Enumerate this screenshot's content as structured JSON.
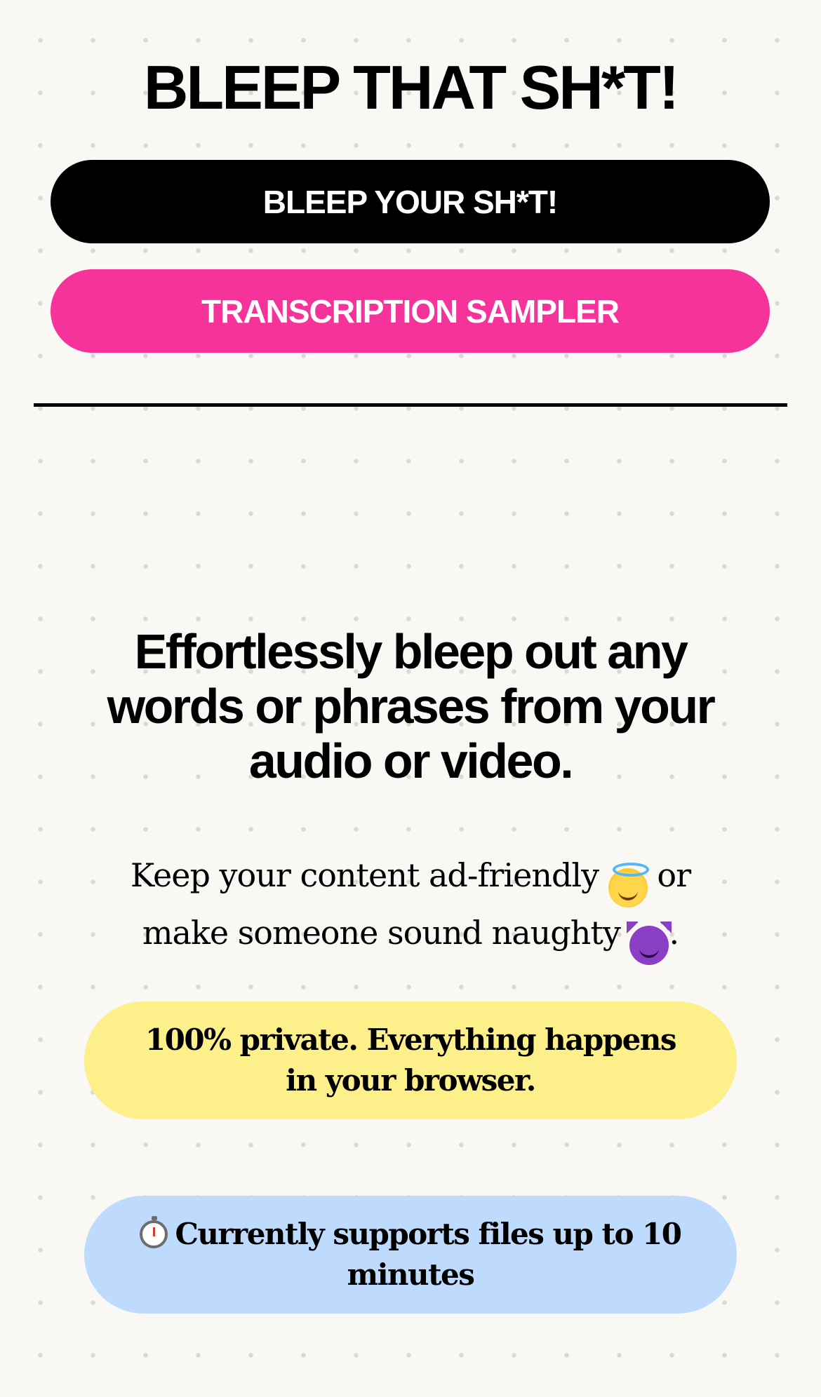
{
  "header": {
    "title": "BLEEP THAT SH*T!"
  },
  "nav": {
    "bleep_button_label": "BLEEP YOUR SH*T!",
    "sampler_button_label": "TRANSCRIPTION SAMPLER"
  },
  "hero": {
    "headline": "Effortlessly bleep out any words or phrases from your audio or video.",
    "subline_part1": "Keep your content ad-friendly",
    "subline_part2": "or make someone sound naughty",
    "subline_part3": ".",
    "angel_emoji": "😇",
    "devil_emoji": "😈"
  },
  "features": {
    "privacy_text": "100% private. Everything happens in your browser.",
    "limit_icon": "stopwatch-icon",
    "limit_text": "Currently supports files up to 10 minutes"
  },
  "colors": {
    "background": "#faf8f4",
    "primary_button": "#000000",
    "secondary_button": "#f5339b",
    "privacy_pill": "#fdf08a",
    "limit_pill": "#bedbfd"
  }
}
